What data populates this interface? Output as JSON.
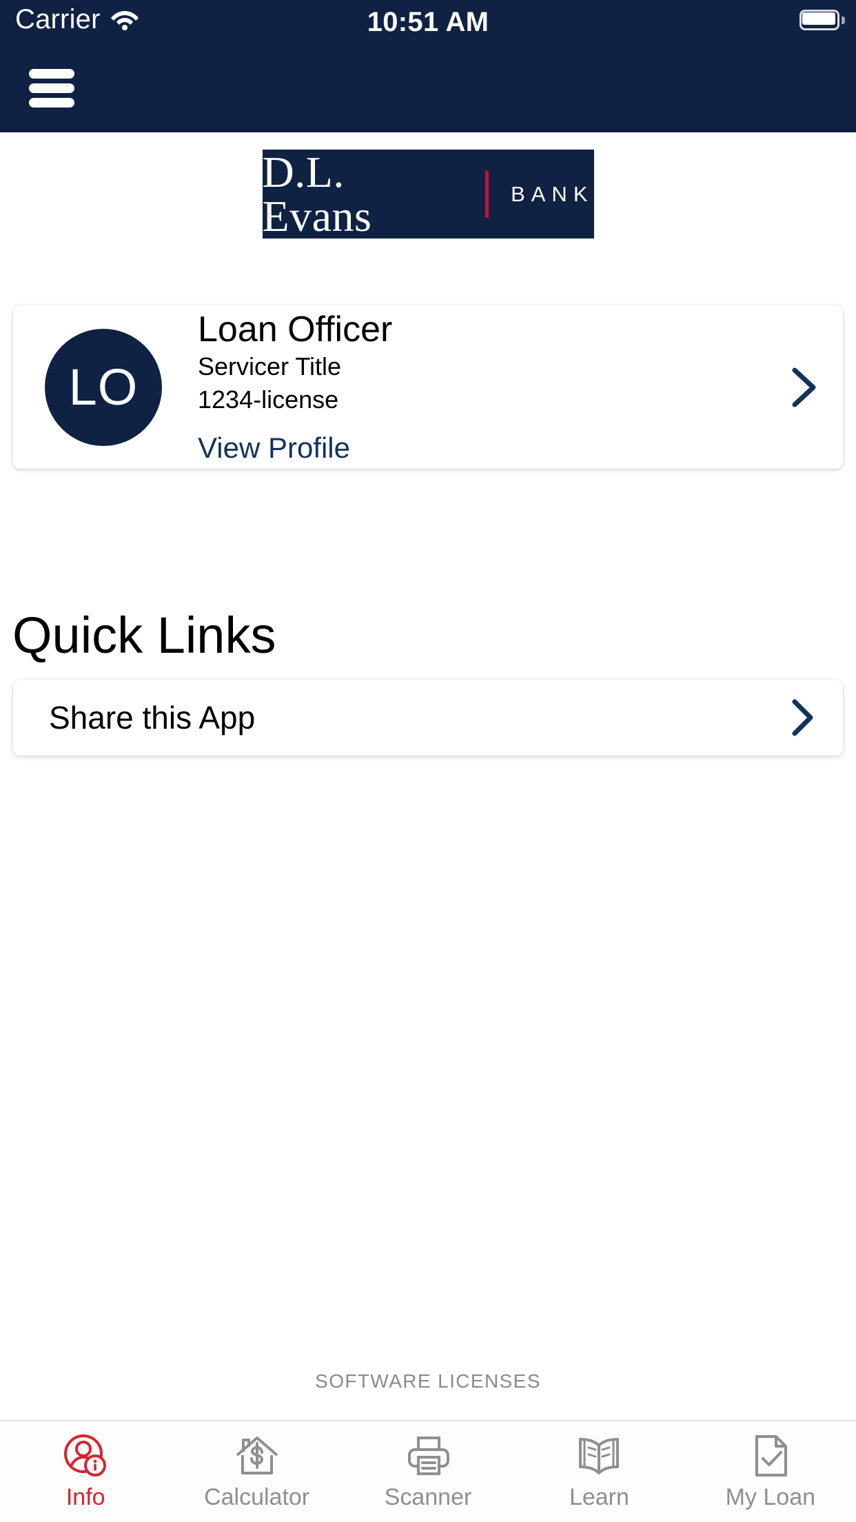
{
  "status_bar": {
    "carrier": "Carrier",
    "time": "10:51 AM",
    "wifi_icon": "wifi-icon",
    "battery_icon": "battery-full-icon"
  },
  "header": {
    "menu_icon": "hamburger-menu-icon",
    "background_color": "#0f2243"
  },
  "logo": {
    "name": "D.L. Evans",
    "bank_word": "BANK",
    "divider_color": "#c8102e",
    "background_color": "#0f2243"
  },
  "officer_card": {
    "avatar_initials": "LO",
    "name": "Loan Officer",
    "title": "Servicer Title",
    "license": "1234-license",
    "view_profile": "View Profile",
    "chevron_icon": "chevron-right-icon",
    "accent_color": "#13335e"
  },
  "quick_links": {
    "heading": "Quick Links",
    "items": [
      {
        "label": "Share this App",
        "chevron_icon": "chevron-right-icon"
      }
    ]
  },
  "footer": {
    "software_licenses": "SOFTWARE LICENSES"
  },
  "tab_bar": {
    "active_color": "#d8232f",
    "inactive_color": "#8e8e93",
    "tabs": [
      {
        "label": "Info",
        "icon": "person-info-circle-icon",
        "active": true
      },
      {
        "label": "Calculator",
        "icon": "house-dollar-icon",
        "active": false
      },
      {
        "label": "Scanner",
        "icon": "printer-scanner-icon",
        "active": false
      },
      {
        "label": "Learn",
        "icon": "open-book-icon",
        "active": false
      },
      {
        "label": "My Loan",
        "icon": "document-check-icon",
        "active": false
      }
    ]
  }
}
